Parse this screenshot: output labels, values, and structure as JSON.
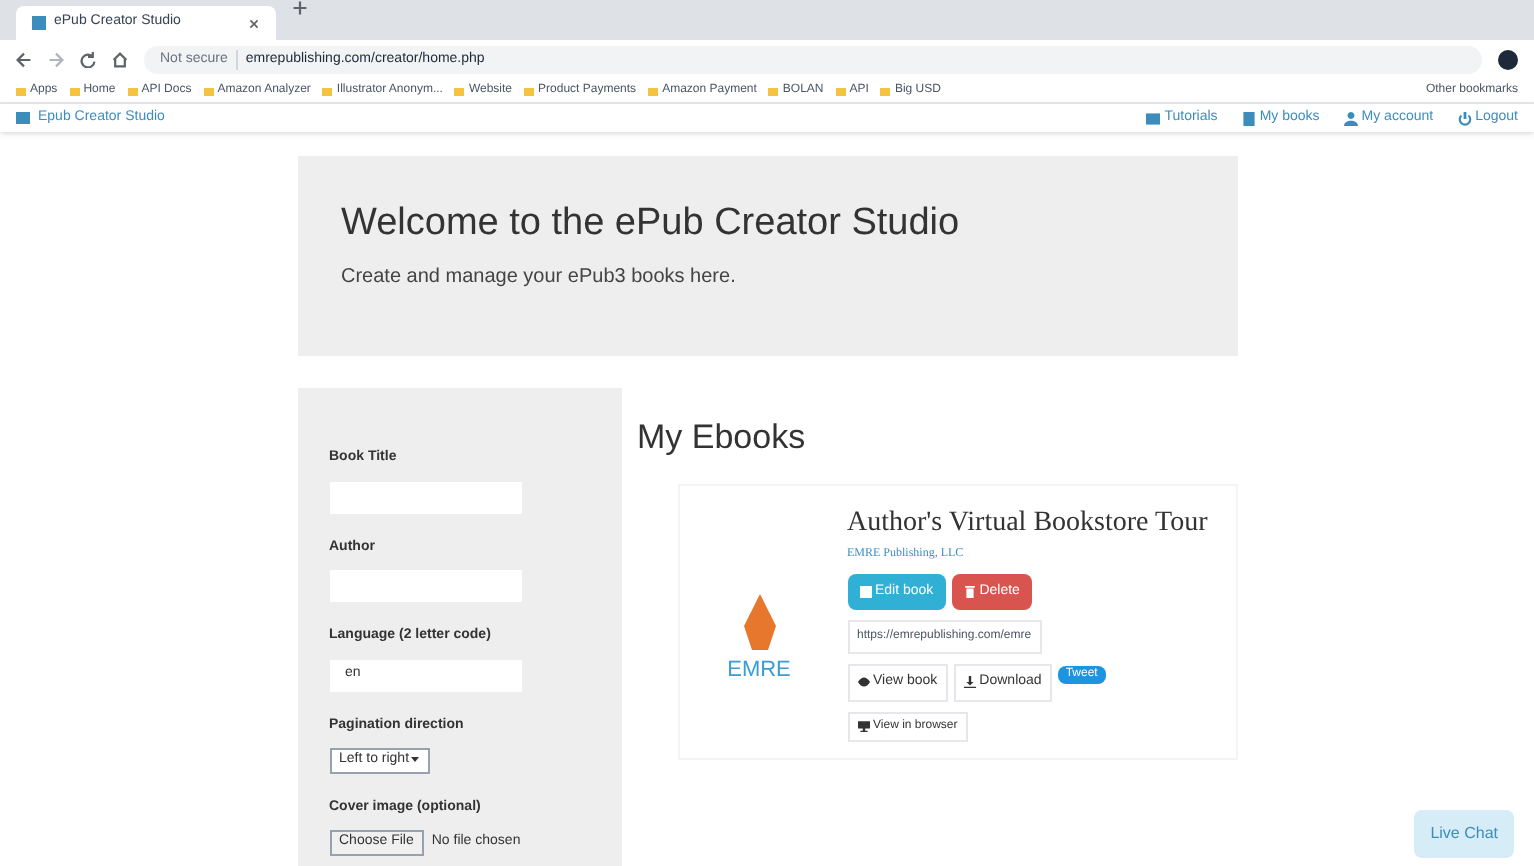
{
  "browser": {
    "tab_title": "ePub Creator Studio",
    "security": "Not secure",
    "url": "emrepublishing.com/creator/home.php",
    "bookmarks": [
      "Apps",
      "Home",
      "API Docs",
      "Amazon Analyzer",
      "Illustrator Anonym...",
      "Website",
      "Product Payments",
      "Amazon Payment",
      "BOLAN",
      "API",
      "Big USD"
    ],
    "other_bookmarks": "Other bookmarks"
  },
  "navbar": {
    "brand": "Epub Creator Studio",
    "links": [
      {
        "label": "Tutorials",
        "kind": "tutorials"
      },
      {
        "label": "My books",
        "kind": "books"
      },
      {
        "label": "My account",
        "kind": "account"
      },
      {
        "label": "Logout",
        "kind": "logout"
      }
    ]
  },
  "welcome": {
    "title": "Welcome to the ePub Creator Studio",
    "subtitle": "Create and manage your ePub3 books here."
  },
  "form": {
    "fields": [
      {
        "kind": "text",
        "label": "Book Title"
      },
      {
        "kind": "text",
        "label": "Author"
      },
      {
        "kind": "text",
        "label": "Language (2 letter code)",
        "value": "en"
      },
      {
        "kind": "select",
        "label": "Pagination direction",
        "value": "Left to right"
      },
      {
        "kind": "file",
        "label": "Cover image (optional)",
        "button": "Choose File",
        "value": "No file chosen"
      }
    ]
  },
  "ebooks": {
    "heading": "My Ebooks",
    "books": [
      {
        "title": "Author's Virtual Bookstore Tour",
        "publisher": "EMRE Publishing, LLC",
        "cover_text": "EMRE",
        "edit": "Edit book",
        "delete": "Delete",
        "link": "https://emrepublishing.com/emre",
        "view": "View book",
        "download": "Download",
        "tweet": "Tweet",
        "browser": "View in browser"
      }
    ]
  },
  "live_chat": "Live Chat"
}
